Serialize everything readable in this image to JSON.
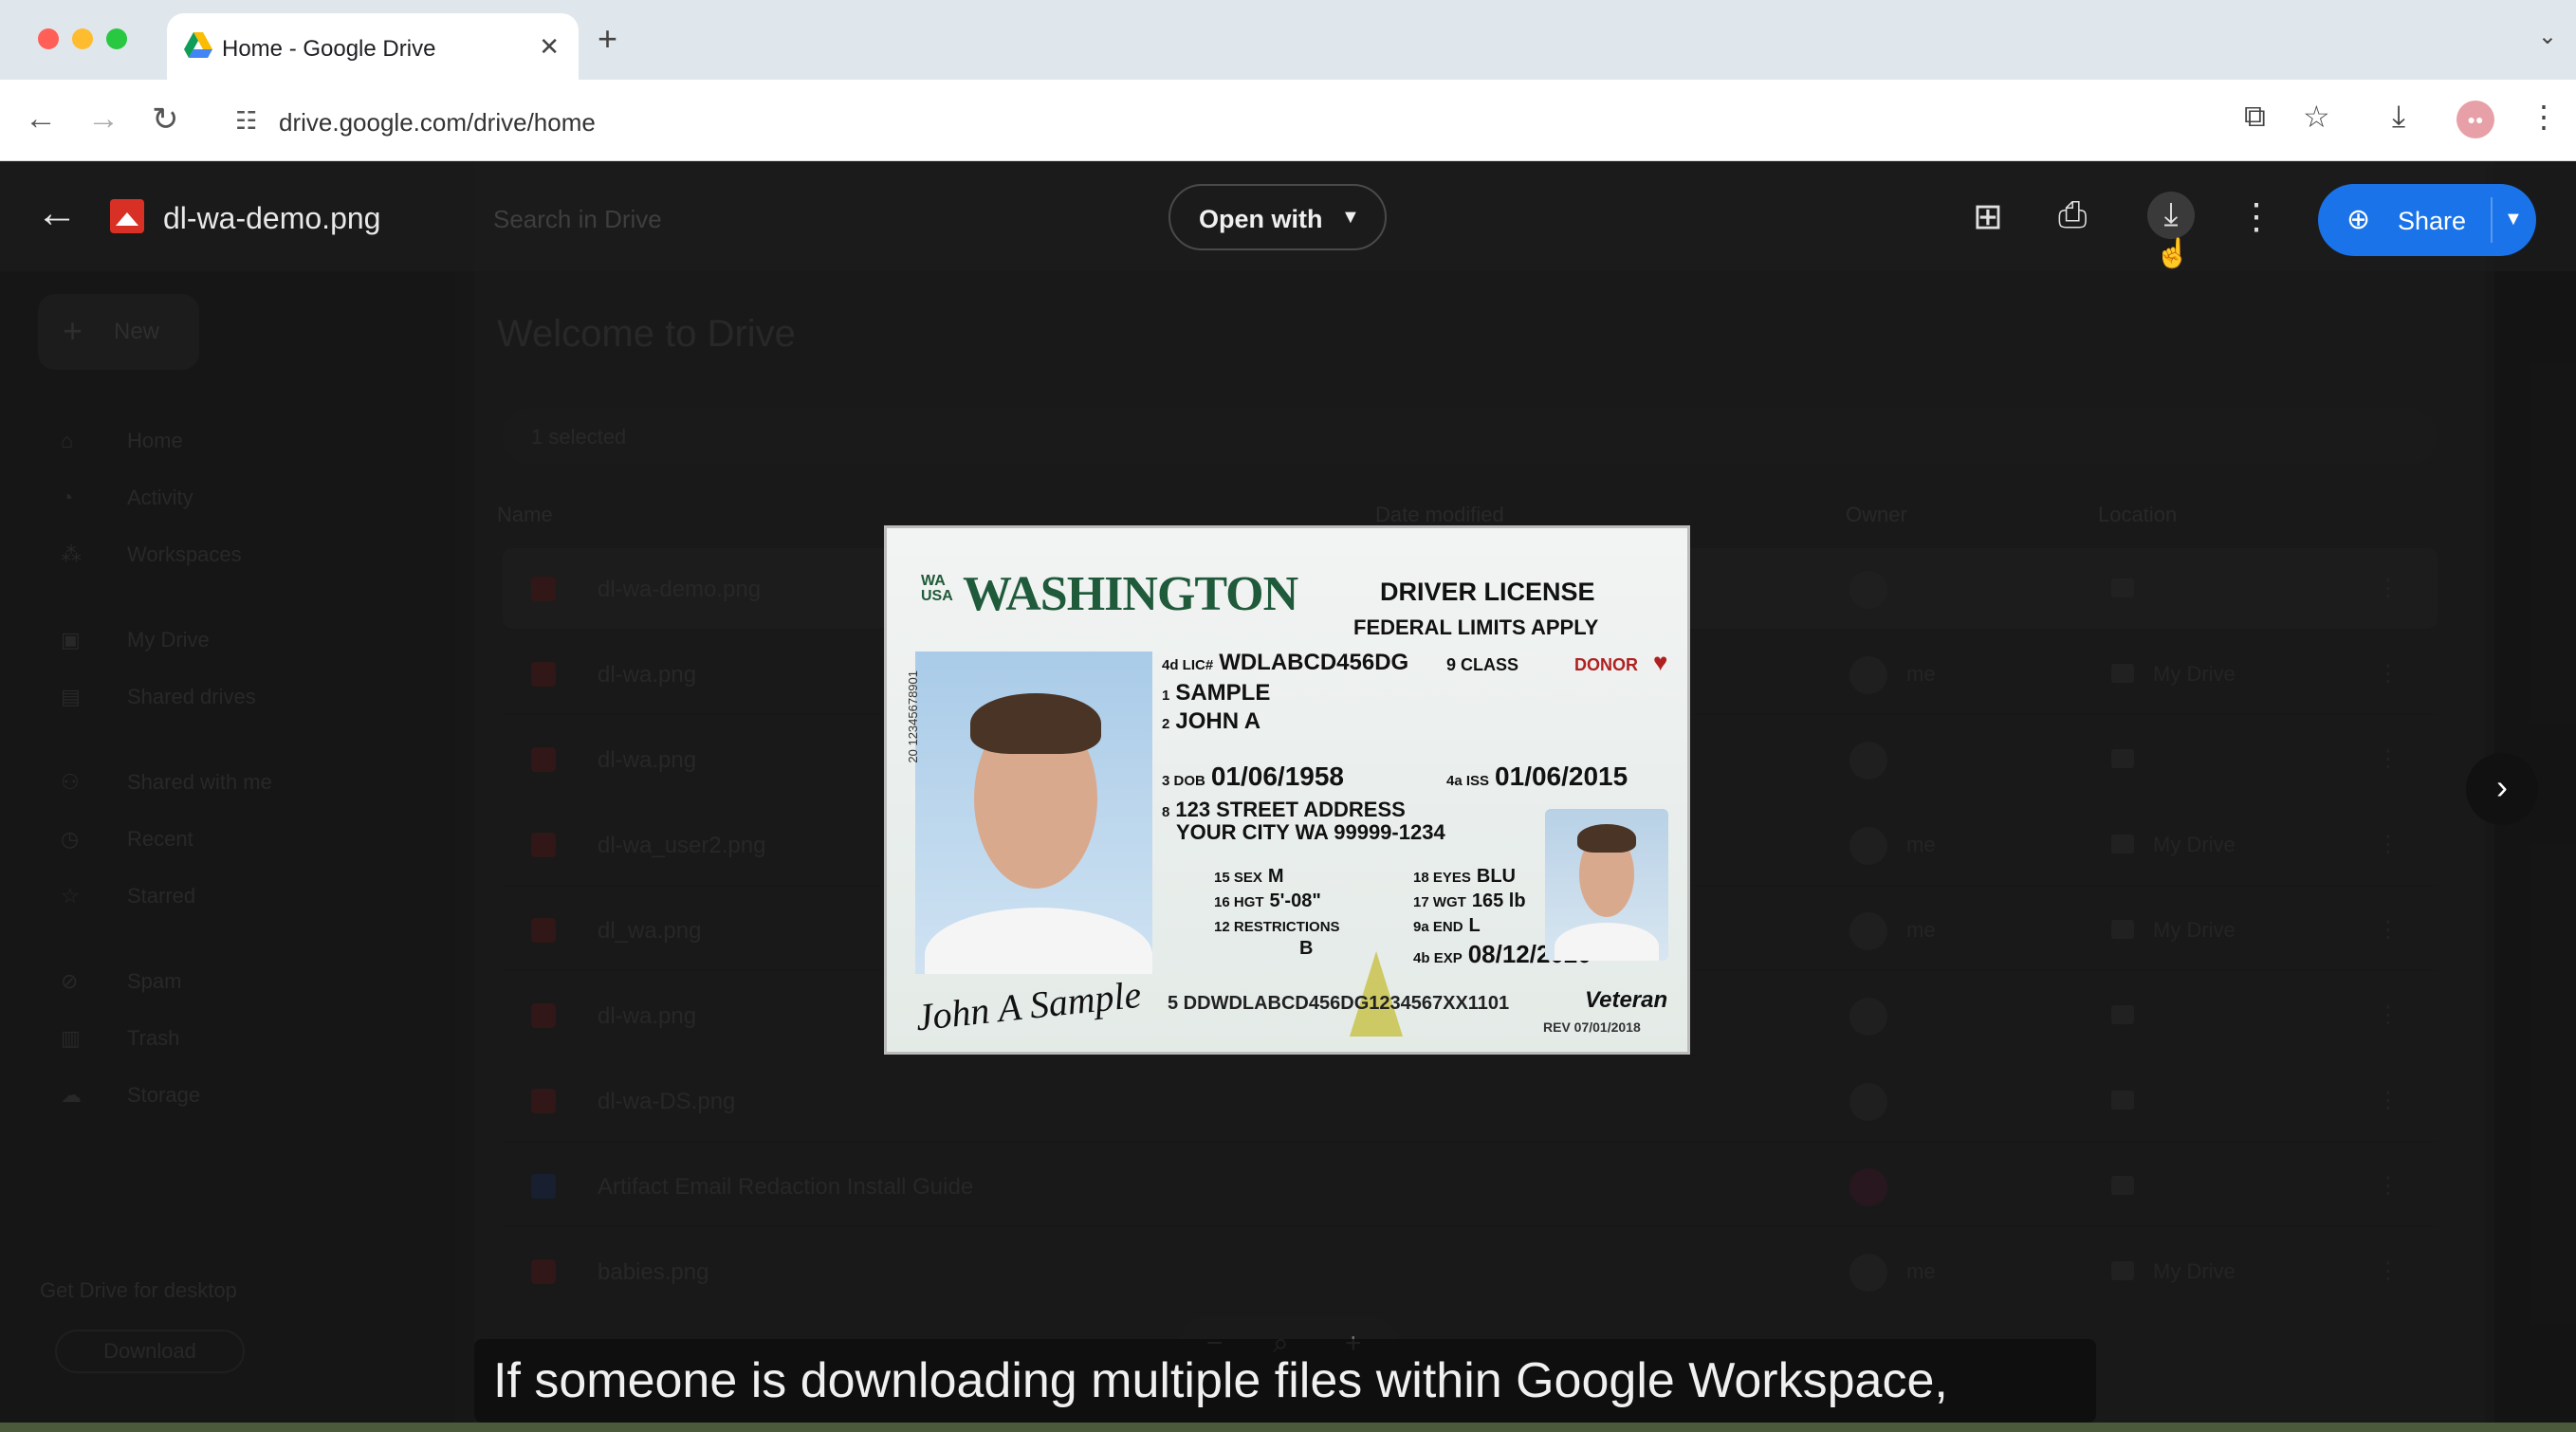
{
  "browser": {
    "tab_title": "Home - Google Drive",
    "new_tab": "+",
    "url": "drive.google.com/drive/home",
    "colors": {
      "close": "#ff5f57",
      "minimize": "#febc2e",
      "maximize": "#28c840"
    }
  },
  "viewer": {
    "file_name": "dl-wa-demo.png",
    "search_placeholder": "Search in Drive",
    "open_with_label": "Open with",
    "share_label": "Share",
    "icons": [
      "add-comment-icon",
      "print-icon",
      "download-icon",
      "more-vert-icon"
    ]
  },
  "drive": {
    "new_label": "New",
    "nav": [
      "Home",
      "Activity",
      "Workspaces",
      "My Drive",
      "Shared drives",
      "Shared with me",
      "Recent",
      "Starred",
      "Spam",
      "Trash",
      "Storage"
    ],
    "welcome": "Welcome to Drive",
    "selected_count": "1 selected",
    "columns": {
      "name": "Name",
      "modified": "Date modified",
      "owner": "Owner",
      "location": "Location"
    },
    "rows": [
      {
        "name": "dl-wa-demo.png",
        "modified": "",
        "owner": "",
        "location": ""
      },
      {
        "name": "dl-wa.png",
        "modified": "",
        "owner": "me",
        "location": "My Drive"
      },
      {
        "name": "dl-wa.png",
        "modified": "",
        "owner": "",
        "location": ""
      },
      {
        "name": "dl-wa_user2.png",
        "modified": "",
        "owner": "me",
        "location": "My Drive"
      },
      {
        "name": "dl_wa.png",
        "modified": "",
        "owner": "me",
        "location": "My Drive"
      },
      {
        "name": "dl-wa.png",
        "modified": "",
        "owner": "",
        "location": ""
      },
      {
        "name": "dl-wa-DS.png",
        "modified": "",
        "owner": "",
        "location": ""
      },
      {
        "name": "Artifact Email Redaction Install Guide",
        "modified": "",
        "owner": "",
        "location": ""
      },
      {
        "name": "babies.png",
        "modified": "",
        "owner": "me",
        "location": "My Drive"
      }
    ],
    "storage_text": "Get Drive for desktop",
    "download_label": "Download"
  },
  "license": {
    "state_small": "WA\nUSA",
    "state": "WASHINGTON",
    "type": "DRIVER LICENSE",
    "federal": "FEDERAL LIMITS APPLY",
    "lic_tag": "4d LIC#",
    "lic_no": "WDLABCD456DG",
    "class_tag": "9 CLASS",
    "donor": "DONOR",
    "last_name": "SAMPLE",
    "first_name": "JOHN A",
    "dob_tag": "DOB",
    "dob": "01/06/1958",
    "iss_tag": "ISS",
    "iss": "01/06/2015",
    "address1": "123 STREET ADDRESS",
    "address2": "YOUR CITY WA 99999-1234",
    "sex_tag": "SEX",
    "sex": "M",
    "hgt_tag": "HGT",
    "hgt": "5'-08\"",
    "restrictions_tag": "RESTRICTIONS",
    "restrictions": "B",
    "eyes_tag": "EYES",
    "eyes": "BLU",
    "wgt_tag": "WGT",
    "wgt": "165 lb",
    "end_tag": "END",
    "end": "L",
    "exp_tag": "EXP",
    "exp": "08/12/2020",
    "vertical_no": "20 12345678901",
    "signature": "John A Sample",
    "dd": "5 DDWDLABCD456DG1234567XX1101",
    "veteran": "Veteran",
    "rev": "REV 07/01/2018"
  },
  "caption": "If someone is downloading multiple files within Google Workspace,"
}
